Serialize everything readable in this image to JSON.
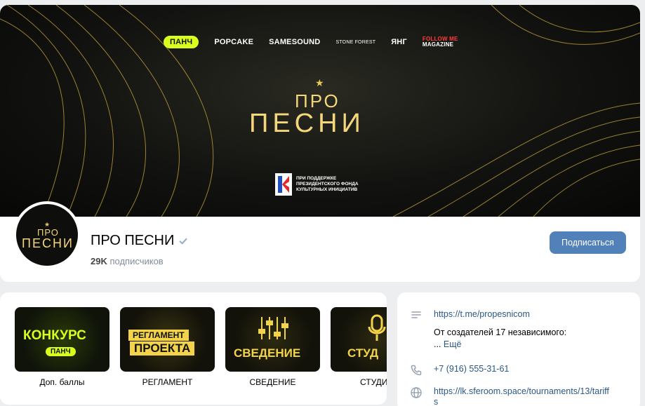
{
  "header": {
    "partners": [
      "ПАНЧ",
      "POPCAKE",
      "SAMESOUND",
      "STONE FOREST",
      "ЯНГ",
      "FOLLOW ME",
      "MAGAZINE"
    ],
    "cover_star": "★",
    "cover_line1": "ПРО",
    "cover_line2": "ПЕСНИ",
    "support_lines": [
      "ПРИ ПОДДЕРЖКЕ",
      "ПРЕЗИДЕНТСКОГО ФОНДА",
      "КУЛЬТУРНЫХ ИНИЦИАТИВ"
    ],
    "group_name": "ПРО ПЕСНИ",
    "subscriber_count": "29K",
    "subscriber_label": "подписчиков",
    "subscribe_label": "Подписаться"
  },
  "links": [
    {
      "tile_line1": "КОНКУРС",
      "tile_line2": "ПАНЧ",
      "caption": "Доп. баллы"
    },
    {
      "tile_line1": "РЕГЛАМЕНТ",
      "tile_line2": "ПРОЕКТА",
      "caption": "РЕГЛАМЕНТ"
    },
    {
      "tile_line1": "СВЕДЕНИЕ",
      "caption": "СВЕДЕНИЕ"
    },
    {
      "tile_line1": "СТУД",
      "caption": "СТУДИ"
    }
  ],
  "info": {
    "telegram": "https://t.me/propesnicom",
    "description": "От создателей 17 независимого:",
    "more_prefix": "... ",
    "more": "Ещё",
    "phone": "+7 (916) 555-31-61",
    "site_line1": "https://lk.sferoom.space/tournaments/13/tariff",
    "site_line2": "s"
  },
  "colors": {
    "accent_button": "#5181b8",
    "link": "#2a5885",
    "brand_lime": "#d8ff1e",
    "brand_gold": "#f4d77a"
  },
  "icons": {
    "verified": "verified-check-icon",
    "description": "lines-icon",
    "phone": "phone-icon",
    "site": "globe-icon"
  }
}
